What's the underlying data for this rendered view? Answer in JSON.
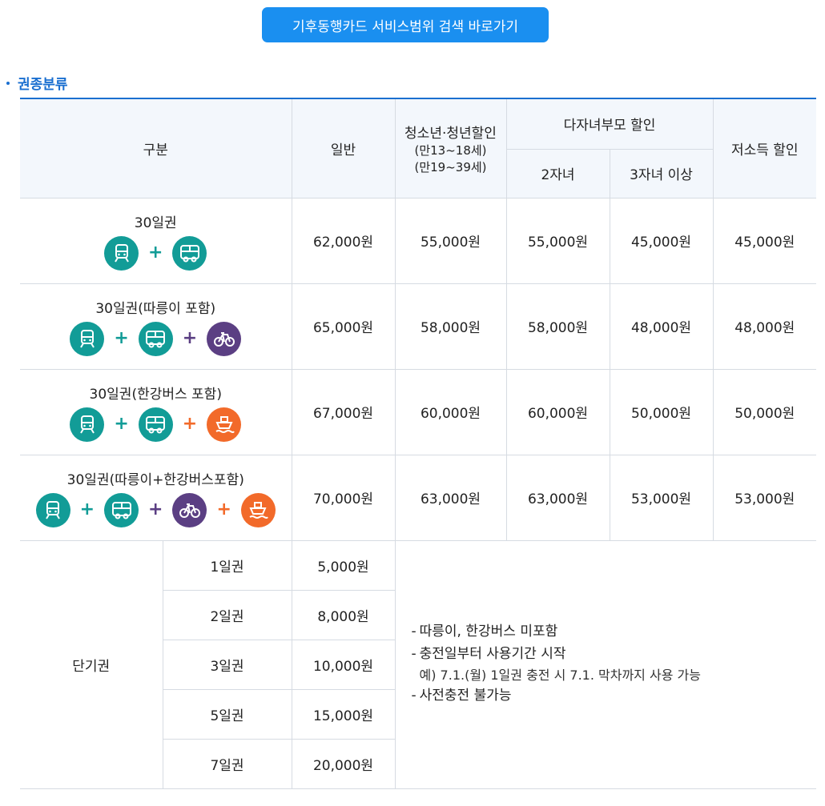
{
  "top_button": "기후동행카드 서비스범위 검색 바로가기",
  "section_title": "권종분류",
  "header": {
    "category": "구분",
    "general": "일반",
    "youth": "청소년·청년할인",
    "youth_age1": "(만13~18세)",
    "youth_age2": "(만19~39세)",
    "multi": "다자녀부모 할인",
    "two": "2자녀",
    "three": "3자녀 이상",
    "low": "저소득 할인"
  },
  "passes": [
    {
      "name": "30일권",
      "general": "62,000원",
      "youth": "55,000원",
      "two": "55,000원",
      "three": "45,000원",
      "low": "45,000원"
    },
    {
      "name": "30일권(따릉이 포함)",
      "general": "65,000원",
      "youth": "58,000원",
      "two": "58,000원",
      "three": "48,000원",
      "low": "48,000원"
    },
    {
      "name": "30일권(한강버스 포함)",
      "general": "67,000원",
      "youth": "60,000원",
      "two": "60,000원",
      "three": "50,000원",
      "low": "50,000원"
    },
    {
      "name": "30일권(따릉이+한강버스포함)",
      "general": "70,000원",
      "youth": "63,000원",
      "two": "63,000원",
      "three": "53,000원",
      "low": "53,000원"
    }
  ],
  "short": {
    "label": "단기권",
    "rows": [
      {
        "name": "1일권",
        "price": "5,000원"
      },
      {
        "name": "2일권",
        "price": "8,000원"
      },
      {
        "name": "3일권",
        "price": "10,000원"
      },
      {
        "name": "5일권",
        "price": "15,000원"
      },
      {
        "name": "7일권",
        "price": "20,000원"
      }
    ],
    "note1": "따릉이, 한강버스 미포함",
    "note2": "충전일부터 사용기간 시작",
    "example": "예) 7.1.(월) 1일권 충전 시 7.1. 막차까지 사용 가능",
    "note3": "사전충전 불가능"
  },
  "icon_colors": {
    "transit": "#129c97",
    "bike": "#5b3f83",
    "boat": "#f26a2a"
  },
  "plus_sign": "+",
  "dash": "-"
}
